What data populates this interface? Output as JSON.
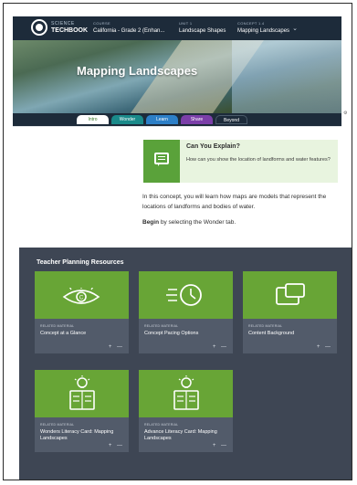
{
  "header": {
    "logo_line1": "SCIENCE",
    "logo_line2": "TECHBOOK",
    "crumbs": [
      {
        "key": "Course",
        "value": "California - Grade 2 (Enhan..."
      },
      {
        "key": "Unit 1",
        "value": "Landscape Shapes"
      },
      {
        "key": "Concept 1.4",
        "value": "Mapping Landscapes"
      }
    ],
    "hero_title": "Mapping Landscapes"
  },
  "tabs": [
    {
      "label": "Intro",
      "color": "#ffffff",
      "active": true
    },
    {
      "label": "Wonder",
      "color": "#1a8a8a",
      "active": false
    },
    {
      "label": "Learn",
      "color": "#2c7fc7",
      "active": false
    },
    {
      "label": "Share",
      "color": "#7b3fa8",
      "active": false
    },
    {
      "label": "Beyond",
      "color": "#1d2b3a",
      "active": false
    }
  ],
  "explain": {
    "title": "Can You Explain?",
    "question": "How can you show the location of landforms and water features?"
  },
  "intro_text": "In this concept, you will learn how maps are models that represent the locations of landforms and bodies of water.",
  "begin": {
    "bold": "Begin",
    "rest": " by selecting the Wonder tab."
  },
  "resources": {
    "title": "Teacher Planning Resources",
    "cards": [
      {
        "kind": "Related Material",
        "name": "Concept at a Glance",
        "icon": "eye-icon"
      },
      {
        "kind": "Related Material",
        "name": "Concept Pacing Options",
        "icon": "clock-icon"
      },
      {
        "kind": "Related Material",
        "name": "Content Background",
        "icon": "windows-icon"
      },
      {
        "kind": "Related Material",
        "name": "Wonders Literacy Card: Mapping Landscapes",
        "icon": "lightbulb-card-icon"
      },
      {
        "kind": "Related Material",
        "name": "Advance Literacy Card: Mapping Landscapes",
        "icon": "lightbulb-card-icon"
      }
    ],
    "card_controls": "+ —"
  },
  "colors": {
    "header_bg": "#1d2b3a",
    "accent_green": "#5aa23a",
    "card_green": "#68a536",
    "panel_bg": "#3e4654"
  }
}
